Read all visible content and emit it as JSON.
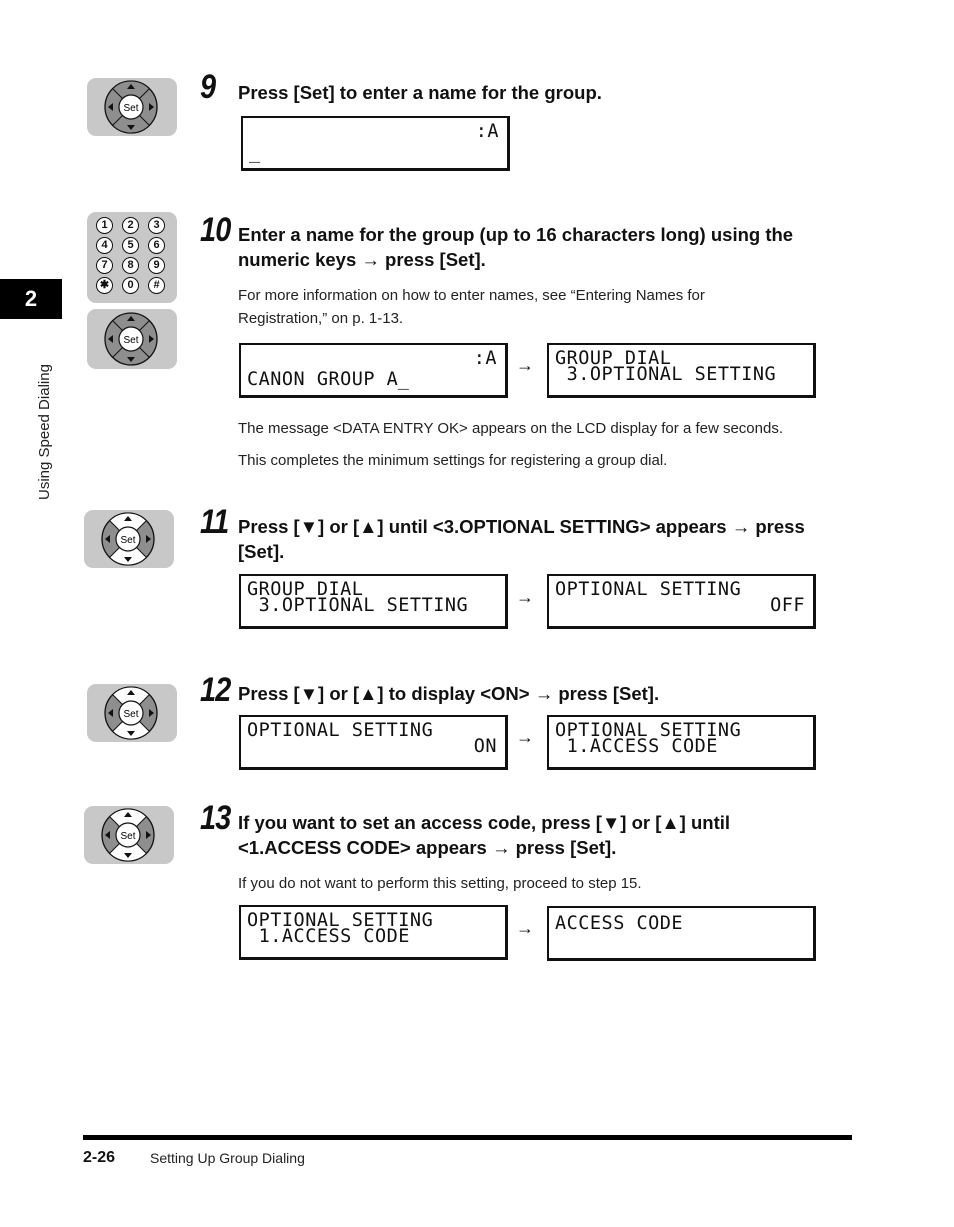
{
  "chapter": {
    "number": "2",
    "title": "Using Speed Dialing"
  },
  "icons": {
    "navpad": "set-navigation-pad-icon",
    "numpad": "numeric-keypad-icon",
    "set_label": "Set"
  },
  "numpad_keys": [
    "1",
    "2",
    "3",
    "4",
    "5",
    "6",
    "7",
    "8",
    "9",
    "✱",
    "0",
    "#"
  ],
  "steps": [
    {
      "number": "9",
      "heading": "Press [Set] to enter a name for the group.",
      "lcds": [
        {
          "line1": ":A",
          "line2": "_"
        }
      ]
    },
    {
      "number": "10",
      "heading": "Enter a name for the group (up to 16 characters long) using the numeric keys → press [Set].",
      "note": "For more information on how to enter names, see “Entering Names for Registration,” on p. 1-13.",
      "lcds": [
        {
          "line1": ":A",
          "line2": "CANON GROUP A̲"
        },
        {
          "line1": "GROUP DIAL",
          "line2": " 3.OPTIONAL SETTING"
        }
      ],
      "after_notes": [
        "The message <DATA ENTRY OK> appears on the LCD display for a few seconds.",
        "This completes the minimum settings for registering a group dial."
      ]
    },
    {
      "number": "11",
      "heading": "Press [▼] or [▲] until <3.OPTIONAL SETTING> appears → press [Set].",
      "lcds": [
        {
          "line1": "GROUP DIAL",
          "line2": " 3.OPTIONAL SETTING"
        },
        {
          "line1": "OPTIONAL SETTING",
          "line2": "OFF"
        }
      ]
    },
    {
      "number": "12",
      "heading": "Press [▼] or [▲] to display <ON> → press [Set].",
      "lcds": [
        {
          "line1": "OPTIONAL SETTING",
          "line2": "ON"
        },
        {
          "line1": "OPTIONAL SETTING",
          "line2": " 1.ACCESS CODE"
        }
      ]
    },
    {
      "number": "13",
      "heading": "If you want to set an access code, press [▼] or [▲] until <1.ACCESS CODE> appears → press [Set].",
      "note": "If you do not want to perform this setting, proceed to step 15.",
      "lcds": [
        {
          "line1": "OPTIONAL SETTING",
          "line2": " 1.ACCESS CODE"
        },
        {
          "line1": "ACCESS CODE",
          "line2": ""
        }
      ]
    }
  ],
  "arrow": "→",
  "footer": {
    "page": "2-26",
    "section": "Setting Up Group Dialing"
  }
}
